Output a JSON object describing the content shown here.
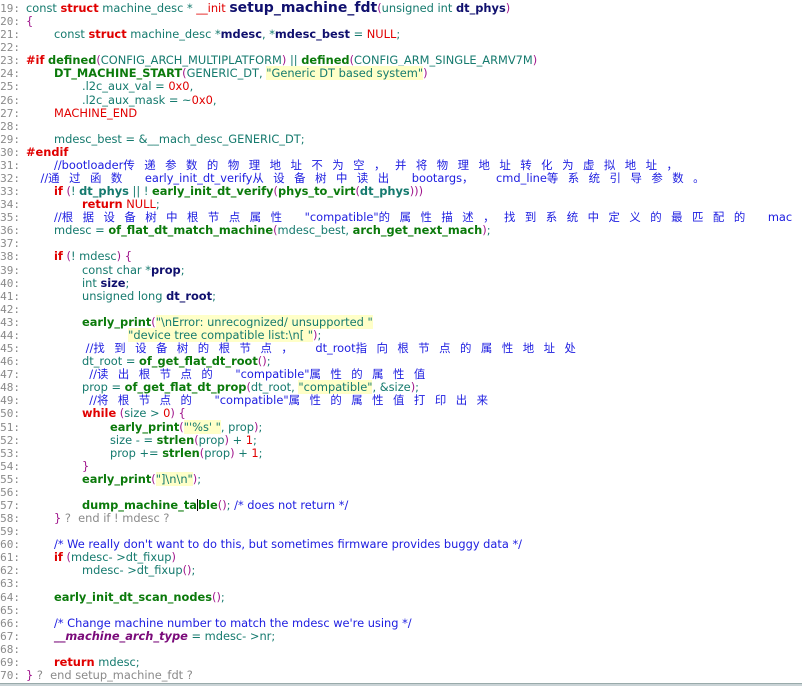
{
  "editor": {
    "lines": [
      {
        "n": "19:",
        "t": [
          [
            "t",
            "const "
          ],
          [
            "k",
            "struct"
          ],
          [
            "t",
            " machine_desc * "
          ],
          [
            "m",
            "__init"
          ],
          [
            "t",
            " "
          ],
          [
            "fn",
            "setup_machine_fdt"
          ],
          [
            "p",
            "("
          ],
          [
            "t",
            "unsigned int "
          ],
          [
            "v",
            "dt_phys"
          ],
          [
            "p",
            ")"
          ]
        ]
      },
      {
        "n": "20:",
        "t": [
          [
            "p",
            "{"
          ]
        ]
      },
      {
        "n": "21:",
        "t": [
          [
            "t",
            "\tconst "
          ],
          [
            "k",
            "struct"
          ],
          [
            "t",
            " machine_desc *"
          ],
          [
            "v",
            "mdesc"
          ],
          [
            "t",
            ", *"
          ],
          [
            "v",
            "mdesc_best"
          ],
          [
            "t",
            " = "
          ],
          [
            "m",
            "NULL"
          ],
          [
            "t",
            ";"
          ]
        ]
      },
      {
        "n": "22:",
        "t": []
      },
      {
        "n": "23:",
        "t": [
          [
            "k",
            "#if"
          ],
          [
            "t",
            " "
          ],
          [
            "f",
            "defined"
          ],
          [
            "p",
            "("
          ],
          [
            "t",
            "CONFIG_ARCH_MULTIPLATFORM"
          ],
          [
            "p",
            ")"
          ],
          [
            "t",
            " || "
          ],
          [
            "f",
            "defined"
          ],
          [
            "p",
            "("
          ],
          [
            "t",
            "CONFIG_ARM_SINGLE_ARMV7M"
          ],
          [
            "p",
            ")"
          ]
        ]
      },
      {
        "n": "24:",
        "t": [
          [
            "t",
            "\t"
          ],
          [
            "f",
            "DT_MACHINE_START"
          ],
          [
            "p",
            "("
          ],
          [
            "t",
            "GENERIC_DT, "
          ],
          [
            "s",
            "\"Generic DT based system\""
          ],
          [
            "p",
            ")"
          ]
        ]
      },
      {
        "n": "25:",
        "t": [
          [
            "t",
            "\t\t.l2c_aux_val = "
          ],
          [
            "n",
            "0x0"
          ],
          [
            "t",
            ","
          ]
        ]
      },
      {
        "n": "26:",
        "t": [
          [
            "t",
            "\t\t.l2c_aux_mask = ~"
          ],
          [
            "n",
            "0x0"
          ],
          [
            "t",
            ","
          ]
        ]
      },
      {
        "n": "27:",
        "t": [
          [
            "t",
            "\t"
          ],
          [
            "m",
            "MACHINE_END"
          ]
        ]
      },
      {
        "n": "28:",
        "t": []
      },
      {
        "n": "29:",
        "t": [
          [
            "t",
            "\tmdesc_best = &__mach_desc_GENERIC_DT;"
          ]
        ]
      },
      {
        "n": "30:",
        "t": [
          [
            "k",
            "#endif"
          ]
        ]
      },
      {
        "n": "31:",
        "t": [
          [
            "t",
            "\t"
          ],
          [
            "c",
            "//bootloader"
          ],
          [
            "cjk",
            "传递参数的物理地址不为空，并将物理地址转化为虚拟地址，"
          ]
        ]
      },
      {
        "n": "32:",
        "t": [
          [
            "t",
            "    "
          ],
          [
            "c",
            "//"
          ],
          [
            "cjk",
            "通过函数 "
          ],
          [
            "c",
            "early_init_dt_verify"
          ],
          [
            "cjk",
            "从设备树中读出 "
          ],
          [
            "c",
            "bootargs"
          ],
          [
            "cjk",
            "， "
          ],
          [
            "c",
            "cmd_line"
          ],
          [
            "cjk",
            "等系统引导参数。"
          ]
        ]
      },
      {
        "n": "33:",
        "t": [
          [
            "t",
            "\t"
          ],
          [
            "k",
            "if"
          ],
          [
            "t",
            " "
          ],
          [
            "p",
            "("
          ],
          [
            "t",
            "! "
          ],
          [
            "vb",
            "dt_phys"
          ],
          [
            "t",
            " || ! "
          ],
          [
            "f",
            "early_init_dt_verify"
          ],
          [
            "p",
            "("
          ],
          [
            "f",
            "phys_to_virt"
          ],
          [
            "p",
            "("
          ],
          [
            "vb",
            "dt_phys"
          ],
          [
            "p",
            ")))"
          ]
        ]
      },
      {
        "n": "34:",
        "t": [
          [
            "t",
            "\t\t"
          ],
          [
            "k",
            "return"
          ],
          [
            "t",
            " "
          ],
          [
            "m",
            "NULL"
          ],
          [
            "t",
            ";"
          ]
        ]
      },
      {
        "n": "35:",
        "t": [
          [
            "t",
            "\t"
          ],
          [
            "c",
            "//"
          ],
          [
            "cjk",
            "根据设备树中根节点属性 "
          ],
          [
            "c",
            "\"compatible\""
          ],
          [
            "cjk",
            "的属性描述，找到系统中定义的最匹配的 "
          ],
          [
            "c",
            "mac"
          ]
        ]
      },
      {
        "n": "36:",
        "t": [
          [
            "t",
            "\tmdesc = "
          ],
          [
            "f",
            "of_flat_dt_match_machine"
          ],
          [
            "p",
            "("
          ],
          [
            "t",
            "mdesc_best, "
          ],
          [
            "f",
            "arch_get_next_mach"
          ],
          [
            "p",
            ")"
          ],
          [
            "t",
            ";"
          ]
        ]
      },
      {
        "n": "37:",
        "t": []
      },
      {
        "n": "38:",
        "t": [
          [
            "t",
            "\t"
          ],
          [
            "k",
            "if"
          ],
          [
            "t",
            " "
          ],
          [
            "p",
            "("
          ],
          [
            "t",
            "! mdesc"
          ],
          [
            "p",
            ")"
          ],
          [
            "t",
            " "
          ],
          [
            "p",
            "{"
          ]
        ]
      },
      {
        "n": "39:",
        "t": [
          [
            "t",
            "\t\tconst char *"
          ],
          [
            "v",
            "prop"
          ],
          [
            "t",
            ";"
          ]
        ]
      },
      {
        "n": "40:",
        "t": [
          [
            "t",
            "\t\tint "
          ],
          [
            "v",
            "size"
          ],
          [
            "t",
            ";"
          ]
        ]
      },
      {
        "n": "41:",
        "t": [
          [
            "t",
            "\t\tunsigned long "
          ],
          [
            "v",
            "dt_root"
          ],
          [
            "t",
            ";"
          ]
        ]
      },
      {
        "n": "42:",
        "t": []
      },
      {
        "n": "43:",
        "t": [
          [
            "t",
            "\t\t"
          ],
          [
            "f",
            "early_print"
          ],
          [
            "p",
            "("
          ],
          [
            "s",
            "\"\\nError: unrecognized/ unsupported \""
          ]
        ]
      },
      {
        "n": "44:",
        "t": [
          [
            "t",
            "\t\t\t     "
          ],
          [
            "s",
            "\"device tree compatible list:\\n[ \""
          ],
          [
            "p",
            ")"
          ],
          [
            "t",
            ";"
          ]
        ]
      },
      {
        "n": "45:",
        "t": [
          [
            "t",
            "\t\t "
          ],
          [
            "c",
            "//"
          ],
          [
            "cjk",
            "找到设备树的根节点， "
          ],
          [
            "c",
            "dt_root"
          ],
          [
            "cjk",
            "指向根节点的属性地址处"
          ]
        ]
      },
      {
        "n": "46:",
        "t": [
          [
            "t",
            "\t\tdt_root = "
          ],
          [
            "f",
            "of_get_flat_dt_root"
          ],
          [
            "p",
            "()"
          ],
          [
            "t",
            ";"
          ]
        ]
      },
      {
        "n": "47:",
        "t": [
          [
            "t",
            "\t\t  "
          ],
          [
            "c",
            "//"
          ],
          [
            "cjk",
            "读出根节点的 "
          ],
          [
            "c",
            "\"compatible\""
          ],
          [
            "cjk",
            "属性的属性值"
          ]
        ]
      },
      {
        "n": "48:",
        "t": [
          [
            "t",
            "\t\tprop = "
          ],
          [
            "f",
            "of_get_flat_dt_prop"
          ],
          [
            "p",
            "("
          ],
          [
            "t",
            "dt_root, "
          ],
          [
            "s",
            "\"compatible\""
          ],
          [
            "t",
            ", &size"
          ],
          [
            "p",
            ")"
          ],
          [
            "t",
            ";"
          ]
        ]
      },
      {
        "n": "49:",
        "t": [
          [
            "t",
            "\t\t  "
          ],
          [
            "c",
            "//"
          ],
          [
            "cjk",
            "将根节点的 "
          ],
          [
            "c",
            "\"compatible\""
          ],
          [
            "cjk",
            "属性的属性值打印出来"
          ]
        ]
      },
      {
        "n": "50:",
        "t": [
          [
            "t",
            "\t\t"
          ],
          [
            "k",
            "while"
          ],
          [
            "t",
            " "
          ],
          [
            "p",
            "("
          ],
          [
            "t",
            "size > "
          ],
          [
            "n",
            "0"
          ],
          [
            "p",
            ")"
          ],
          [
            "t",
            " "
          ],
          [
            "p",
            "{"
          ]
        ]
      },
      {
        "n": "51:",
        "t": [
          [
            "t",
            "\t\t\t"
          ],
          [
            "f",
            "early_print"
          ],
          [
            "p",
            "("
          ],
          [
            "s",
            "\"'%s' \""
          ],
          [
            "t",
            ", prop"
          ],
          [
            "p",
            ")"
          ],
          [
            "t",
            ";"
          ]
        ]
      },
      {
        "n": "52:",
        "t": [
          [
            "t",
            "\t\t\tsize - = "
          ],
          [
            "f",
            "strlen"
          ],
          [
            "p",
            "("
          ],
          [
            "t",
            "prop"
          ],
          [
            "p",
            ")"
          ],
          [
            "t",
            " + "
          ],
          [
            "n",
            "1"
          ],
          [
            "t",
            ";"
          ]
        ]
      },
      {
        "n": "53:",
        "t": [
          [
            "t",
            "\t\t\tprop += "
          ],
          [
            "f",
            "strlen"
          ],
          [
            "p",
            "("
          ],
          [
            "t",
            "prop"
          ],
          [
            "p",
            ")"
          ],
          [
            "t",
            " + "
          ],
          [
            "n",
            "1"
          ],
          [
            "t",
            ";"
          ]
        ]
      },
      {
        "n": "54:",
        "t": [
          [
            "t",
            "\t\t"
          ],
          [
            "p",
            "}"
          ]
        ]
      },
      {
        "n": "55:",
        "t": [
          [
            "t",
            "\t\t"
          ],
          [
            "f",
            "early_print"
          ],
          [
            "p",
            "("
          ],
          [
            "s",
            "\"]\\n\\n\""
          ],
          [
            "p",
            ")"
          ],
          [
            "t",
            ";"
          ]
        ]
      },
      {
        "n": "56:",
        "t": []
      },
      {
        "n": "57:",
        "t": [
          [
            "t",
            "\t\t"
          ],
          [
            "f",
            "dump_machine_ta"
          ],
          [
            "cursor",
            ""
          ],
          [
            "f",
            "ble"
          ],
          [
            "p",
            "()"
          ],
          [
            "t",
            "; "
          ],
          [
            "c",
            "/* does not return */"
          ]
        ]
      },
      {
        "n": "58:",
        "t": [
          [
            "t",
            "\t"
          ],
          [
            "p",
            "}"
          ],
          [
            "g",
            " ?  end if ! mdesc ?"
          ]
        ]
      },
      {
        "n": "59:",
        "t": []
      },
      {
        "n": "60:",
        "t": [
          [
            "t",
            "\t"
          ],
          [
            "c",
            "/* We really don't want to do this, but sometimes firmware provides buggy data */"
          ]
        ]
      },
      {
        "n": "61:",
        "t": [
          [
            "t",
            "\t"
          ],
          [
            "k",
            "if"
          ],
          [
            "t",
            " "
          ],
          [
            "p",
            "("
          ],
          [
            "t",
            "mdesc- >dt_fixup"
          ],
          [
            "p",
            ")"
          ]
        ]
      },
      {
        "n": "62:",
        "t": [
          [
            "t",
            "\t\tmdesc- >dt_fixup"
          ],
          [
            "p",
            "()"
          ],
          [
            "t",
            ";"
          ]
        ]
      },
      {
        "n": "63:",
        "t": []
      },
      {
        "n": "64:",
        "t": [
          [
            "t",
            "\t"
          ],
          [
            "f",
            "early_init_dt_scan_nodes"
          ],
          [
            "p",
            "()"
          ],
          [
            "t",
            ";"
          ]
        ]
      },
      {
        "n": "65:",
        "t": []
      },
      {
        "n": "66:",
        "t": [
          [
            "t",
            "\t"
          ],
          [
            "c",
            "/* Change machine number to match the mdesc we're using */"
          ]
        ]
      },
      {
        "n": "67:",
        "t": [
          [
            "t",
            "\t"
          ],
          [
            "it",
            "__machine_arch_type"
          ],
          [
            "t",
            " = mdesc- >nr;"
          ]
        ]
      },
      {
        "n": "68:",
        "t": []
      },
      {
        "n": "69:",
        "t": [
          [
            "t",
            "\t"
          ],
          [
            "k",
            "return"
          ],
          [
            "t",
            " mdesc;"
          ]
        ]
      },
      {
        "n": "70:",
        "t": [
          [
            "p",
            "}"
          ],
          [
            "g",
            " ?  end setup_machine_fdt ?"
          ]
        ]
      }
    ]
  }
}
